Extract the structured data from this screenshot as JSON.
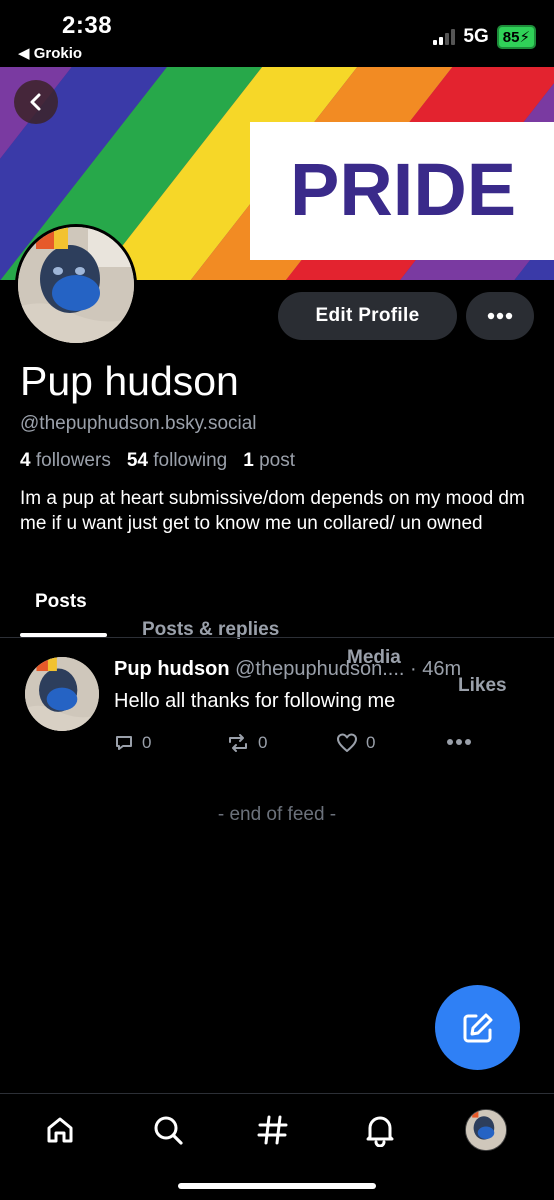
{
  "status": {
    "time": "2:38",
    "back_app": "Grokio",
    "network": "5G",
    "battery": "85"
  },
  "banner": {
    "text": "PRIDE"
  },
  "profile": {
    "display_name": "Pup hudson",
    "handle": "@thepuphudson.bsky.social",
    "followers_count": "4",
    "followers_label": "followers",
    "following_count": "54",
    "following_label": "following",
    "posts_count": "1",
    "posts_label": "post",
    "bio": "Im a pup at heart submissive/dom depends on my mood dm me if u want just get to know me un collared/ un owned",
    "edit_label": "Edit Profile"
  },
  "tabs": [
    {
      "label": "Posts",
      "active": true
    },
    {
      "label": "Posts & replies",
      "active": false
    },
    {
      "label": "Media",
      "active": false
    },
    {
      "label": "Likes",
      "active": false
    }
  ],
  "post": {
    "author": "Pup hudson",
    "handle": "@thepuphudson....",
    "time": "· 46m",
    "text": "Hello all thanks for following me",
    "replies": "0",
    "reposts": "0",
    "likes": "0"
  },
  "feed_end": "- end of feed -",
  "icons": {
    "back": "chevron-left-icon",
    "more": "ellipsis-icon",
    "compose": "compose-icon",
    "nav": [
      "home-icon",
      "search-icon",
      "hashtag-icon",
      "bell-icon",
      "avatar"
    ]
  },
  "colors": {
    "accent": "#2f80f5",
    "muted": "#9aa0aa",
    "button_bg": "#2a2d33"
  }
}
